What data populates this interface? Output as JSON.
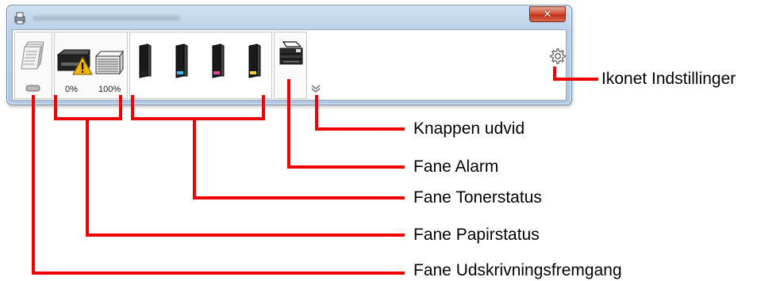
{
  "window": {
    "close_label": "✕"
  },
  "tabs": {
    "paper": {
      "tray1_percent": "0%",
      "tray2_percent": "100%",
      "warning": true
    },
    "toner": {
      "cartridges": [
        {
          "color_name": "black",
          "accent": "#222222"
        },
        {
          "color_name": "cyan",
          "accent": "#3fb8e8"
        },
        {
          "color_name": "magenta",
          "accent": "#e0489a"
        },
        {
          "color_name": "yellow",
          "accent": "#f2d82a"
        }
      ]
    }
  },
  "callouts": {
    "settings": "Ikonet Indstillinger",
    "expand": "Knappen udvid",
    "alarm": "Fane Alarm",
    "toner": "Fane Tonerstatus",
    "paper": "Fane Papirstatus",
    "progress": "Fane Udskrivningsfremgang"
  },
  "colors": {
    "callout_line": "#ee0000",
    "window_frame": "#b8cfe8",
    "close_button": "#c2301a"
  }
}
